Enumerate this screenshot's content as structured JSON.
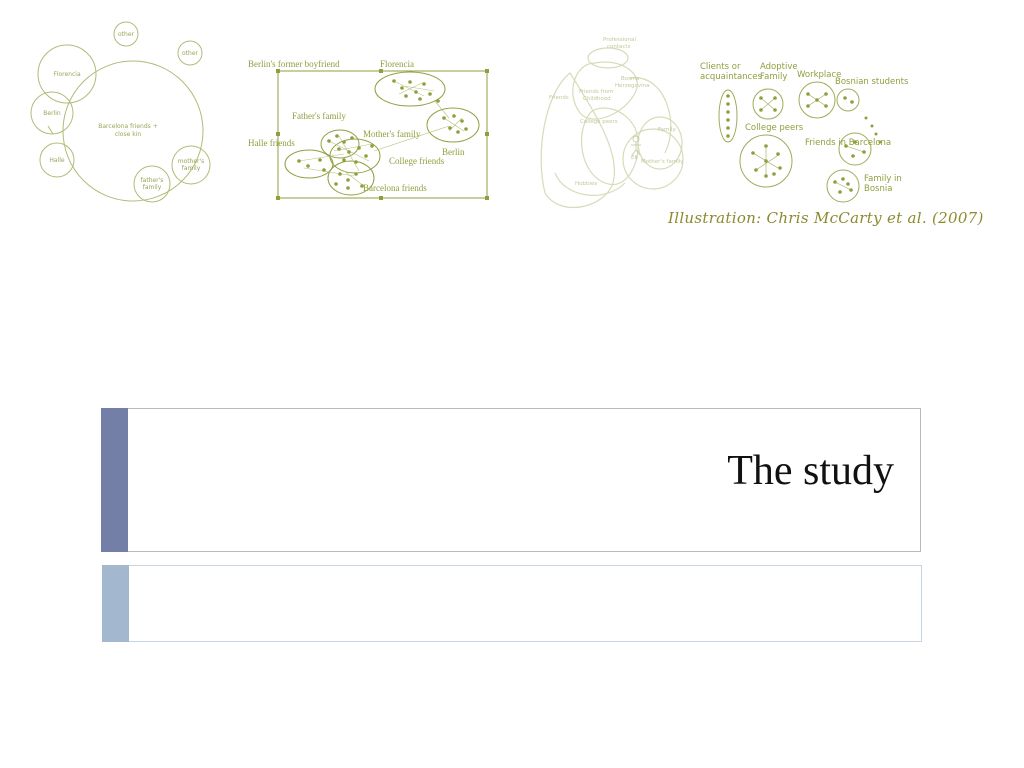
{
  "diagram1": {
    "center": "Barcelona friends + close kin",
    "center_line1": "Barcelona friends +",
    "center_line2": "close kin",
    "florencia": "Florencia",
    "berlin": "Berlin",
    "halle": "Halle",
    "other_top": "other",
    "other_right": "other",
    "mothers_family": "mother's family",
    "mothers_line1": "mother's",
    "mothers_line2": "family",
    "fathers_family": "father's family",
    "fathers_line1": "father's",
    "fathers_line2": "family"
  },
  "diagram2": {
    "berlins_former_boyfriend": "Berlin's former boyfriend",
    "florencia": "Florencia",
    "fathers_family": "Father's family",
    "halle_friends": "Halle friends",
    "mothers_family": "Mother's family",
    "berlin": "Berlin",
    "college_friends": "College friends",
    "barcelona_friends": "Barcelona friends"
  },
  "diagram3": {
    "professional_contacts_1": "Professional",
    "professional_contacts_2": "contacts",
    "bosnia_1": "Bosnia",
    "bosnia_2": "Herzegovina",
    "friends": "Friends",
    "friends_from_1": "Friends from",
    "friends_from_2": "Childhood",
    "college_peers": "College peers",
    "family": "Family",
    "ego": "EK",
    "mothers_family": "Mother's family",
    "hobbies": "Hobbies"
  },
  "diagram4": {
    "clients_1": "Clients or",
    "clients_2": "acquaintances",
    "adoptive_1": "Adoptive",
    "adoptive_2": "Family",
    "workplace": "Workplace",
    "bosnian_students": "Bosnian students",
    "college_peers": "College peers",
    "friends_barcelona": "Friends in Barcelona",
    "family_bosnia_1": "Family in",
    "family_bosnia_2": "Bosnia"
  },
  "credit": "Illustration: Chris McCarty et al. (2007)",
  "slide_title": "The study",
  "colors": {
    "diagram_green": "#8ea03e",
    "diagram_light": "#d4d8b0",
    "accent_dark": "#737fa6",
    "accent_light": "#a3b8cf"
  }
}
